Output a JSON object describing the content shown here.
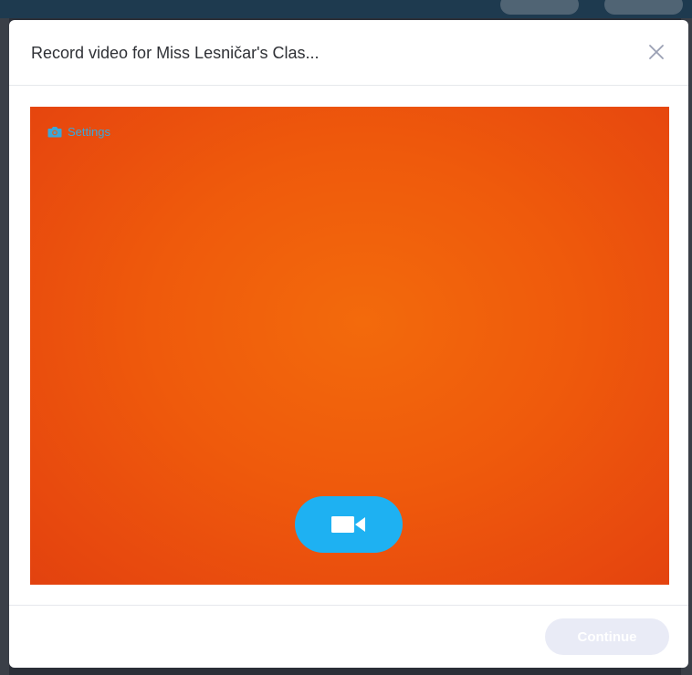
{
  "modal": {
    "title": "Record video for Miss Lesničar's Clas...",
    "close_icon": "close-x-icon"
  },
  "video": {
    "settings_label": "Settings",
    "settings_icon": "camera-icon",
    "record_icon": "video-camera-icon",
    "preview_color": "#ef5a0c"
  },
  "footer": {
    "continue_label": "Continue",
    "continue_enabled": false
  },
  "colors": {
    "accent": "#1eb1f2",
    "settings_text": "#3aa7da",
    "disabled_button": "#e9ebf6"
  }
}
